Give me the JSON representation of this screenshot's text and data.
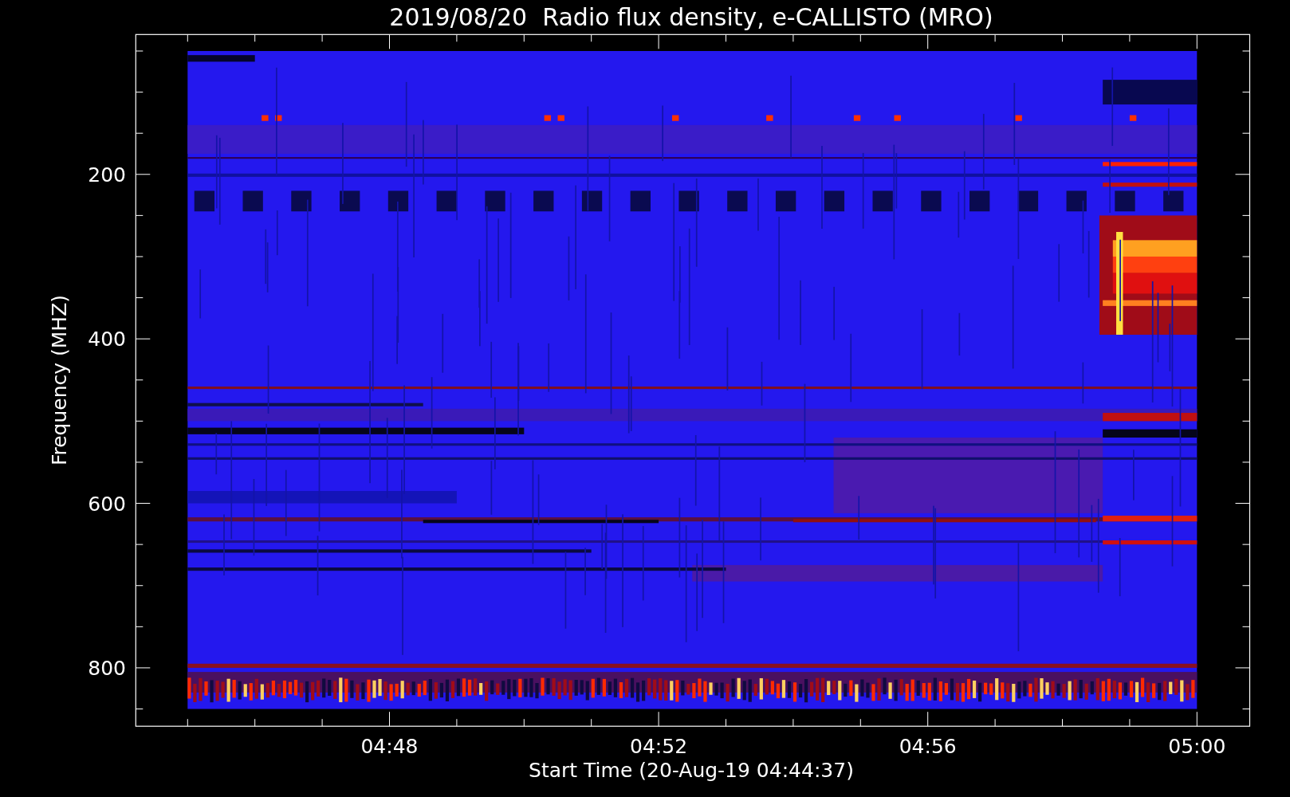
{
  "title": "2019/08/20  Radio flux density, e-CALLISTO (MRO)",
  "y_axis": {
    "label": "Frequency (MHZ)",
    "ticks": [
      "200",
      "400",
      "600",
      "800"
    ]
  },
  "x_axis": {
    "label": "Start Time (20-Aug-19 04:44:37)",
    "ticks": [
      "04:48",
      "04:52",
      "04:56",
      "05:00"
    ]
  }
}
